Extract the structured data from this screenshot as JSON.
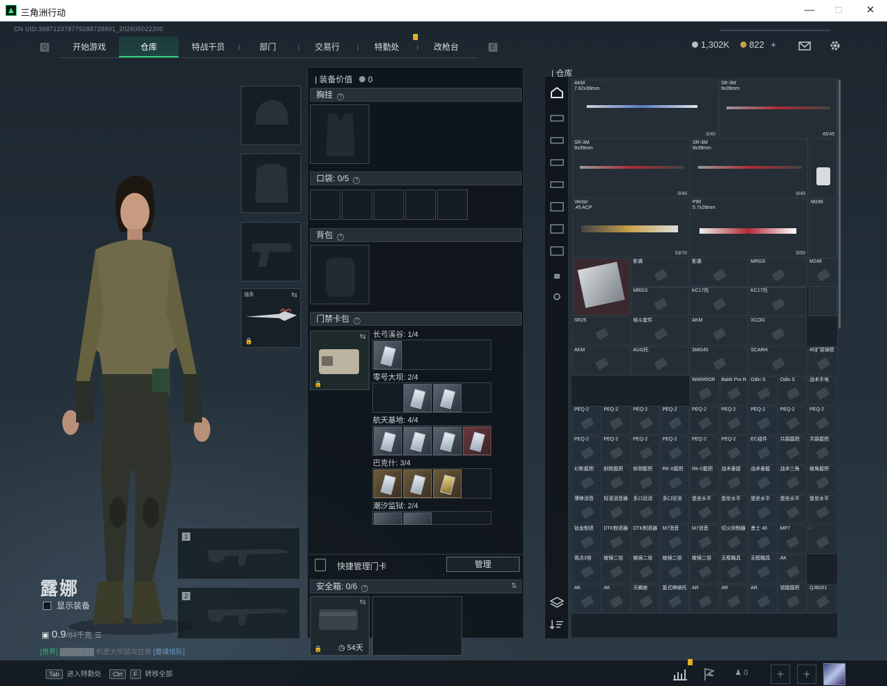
{
  "window": {
    "title": "三角洲行动"
  },
  "uid": "CN UID:368712378779288728891_202605022200",
  "nav": {
    "tabs": [
      "开始游戏",
      "仓库",
      "特战干员",
      "部门",
      "交易行",
      "特勤处",
      "改枪台"
    ],
    "active": 1
  },
  "currency": {
    "silver": "1,302K",
    "gold": "822",
    "plus": "+"
  },
  "character": {
    "name": "露娜",
    "show_gear": "显示装备",
    "weight": "0.9",
    "weight_max": "/84千克"
  },
  "chat": {
    "prefix": "[世界]",
    "mid": "机密大坝猛攻拉我",
    "link": "[邀请组队]"
  },
  "melee": {
    "label": "链条"
  },
  "weapon_slots": [
    "1",
    "2"
  ],
  "middle": {
    "equip_value_label": "装备价值",
    "equip_value": "0",
    "chest_rig": "胸挂",
    "pockets": "口袋:",
    "pockets_val": "0/5",
    "backpack": "背包",
    "keycard": "门禁卡包",
    "card_groups": [
      {
        "title": "长弓溪谷: 1/4"
      },
      {
        "title": "零号大坝: 2/4"
      },
      {
        "title": "航天基地: 4/4"
      },
      {
        "title": "巴克什: 3/4"
      },
      {
        "title": "潮汐监狱: 2/4"
      }
    ],
    "quick_manage": "快捷管理门卡",
    "manage_btn": "管理",
    "safe_box": "安全箱:",
    "safe_box_val": "0/6",
    "safe_timer": "54天"
  },
  "warehouse": {
    "title": "仓库",
    "items": [
      {
        "name": "AKM\n7.62x39mm",
        "count": "0/40"
      },
      {
        "name": "SR-3M\n9x39mm",
        "count": "45/45"
      },
      {
        "name": "SR-3M\n9x39mm",
        "count": "0/45"
      },
      {
        "name": "SR-3M\n9x39mm",
        "count": "0/45"
      },
      {
        "name": "Vector\n.45 ACP",
        "count": "53/70"
      },
      {
        "name": "P90\n5.7x28mm",
        "count": "0/50"
      },
      {
        "name": "M249",
        "count": ""
      }
    ],
    "small": [
      [
        "影袭",
        "影袭",
        "MRGS",
        "M249"
      ],
      [
        "MRGS",
        "KC17托",
        "KC17托"
      ],
      [
        "SR25",
        "格斗套件",
        "AKM",
        "XCOG"
      ],
      [
        "AKM",
        "AUG托",
        "SMG45",
        "SCARH",
        "45扩容弹匣"
      ],
      [
        "WARRIOR",
        "Baldr Pro R",
        "Odin S",
        "Odin S",
        "战术手电"
      ],
      [
        "PEQ-2",
        "PEQ-2",
        "PEQ-2",
        "PEQ-2",
        "PEQ-2",
        "PEQ-2",
        "PEQ-2",
        "PEQ-2",
        "PEQ-2"
      ],
      [
        "PEQ-2",
        "PEQ-2",
        "PEQ-2",
        "PEQ-2",
        "PEQ-2",
        "PEQ-2",
        "EC组件",
        "共振握把",
        "共振握把"
      ],
      [
        "幻影握把",
        "斜侧握把",
        "斜侧握把",
        "RK-0握把",
        "RK-0握把",
        "战术垂握",
        "战术垂握",
        "战术三角",
        "棱角握把"
      ],
      [
        "薄锋消音",
        "轻语消音器",
        "多口径消",
        "多口径消",
        "堡垒水平",
        "堡垒水平",
        "堡垒水平",
        "堡垒水平",
        "堡垒水平"
      ],
      [
        "钛金制退",
        "DTK制退器",
        "DTK制退器",
        "M7消音",
        "M7消音",
        "切火抑制器",
        "勇士 46",
        "MP7",
        "-"
      ],
      [
        "观点3倍",
        "棱镜二倍",
        "棱镜二倍",
        "棱镜二倍",
        "棱镜二倍",
        "无框瞄具",
        "无框瞄具",
        "AK"
      ],
      [
        "AK",
        "AK",
        "天蝎座",
        "复式伸缩托",
        "AR",
        "AR",
        "AR",
        "锁握握把",
        "QJB201"
      ]
    ]
  },
  "bottom": {
    "hint1_key": "Tab",
    "hint1": "进入特勤处",
    "hint2_key": "Ctrl",
    "hint2_key2": "F",
    "hint2": "转移全部",
    "friends": "0"
  }
}
